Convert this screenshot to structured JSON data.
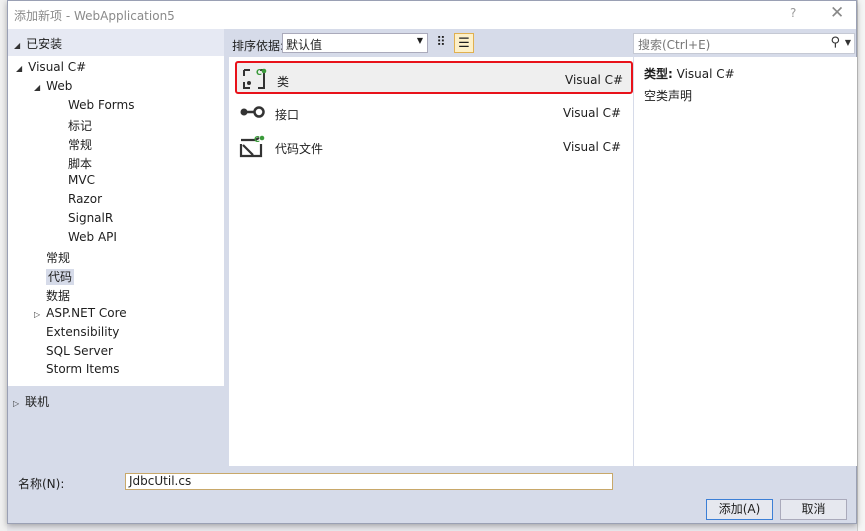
{
  "window": {
    "title": "添加新项 - WebApplication5",
    "help": "?",
    "close": "✕"
  },
  "left": {
    "installed": "已安装",
    "online": "联机",
    "tree": [
      {
        "label": "Visual C#",
        "level": 0,
        "expander": "open"
      },
      {
        "label": "Web",
        "level": 1,
        "expander": "open"
      },
      {
        "label": "Web Forms",
        "level": 2
      },
      {
        "label": "标记",
        "level": 2
      },
      {
        "label": "常规",
        "level": 2
      },
      {
        "label": "脚本",
        "level": 2
      },
      {
        "label": "MVC",
        "level": 2
      },
      {
        "label": "Razor",
        "level": 2
      },
      {
        "label": "SignalR",
        "level": 2
      },
      {
        "label": "Web API",
        "level": 2
      },
      {
        "label": "常规",
        "level": 1
      },
      {
        "label": "代码",
        "level": 1,
        "selected": true
      },
      {
        "label": "数据",
        "level": 1
      },
      {
        "label": "ASP.NET Core",
        "level": 1,
        "expander": "closed"
      },
      {
        "label": "Extensibility",
        "level": 1
      },
      {
        "label": "SQL Server",
        "level": 1
      },
      {
        "label": "Storm Items",
        "level": 1
      }
    ]
  },
  "sort": {
    "label": "排序依据:",
    "value": "默认值"
  },
  "search": {
    "placeholder": "搜索(Ctrl+E)"
  },
  "templates": [
    {
      "name": "类",
      "lang": "Visual C#",
      "icon": "class-icon",
      "selected": true
    },
    {
      "name": "接口",
      "lang": "Visual C#",
      "icon": "interface-icon"
    },
    {
      "name": "代码文件",
      "lang": "Visual C#",
      "icon": "code-file-icon"
    }
  ],
  "details": {
    "type_label": "类型:",
    "type_value": "Visual C#",
    "description": "空类声明"
  },
  "footer": {
    "name_label": "名称(N):",
    "name_value": "JdbcUtil.cs",
    "add": "添加(A)",
    "cancel": "取消"
  },
  "colors": {
    "selection_border": "#e8121a",
    "csharp_badge": "#3a9a3a"
  }
}
